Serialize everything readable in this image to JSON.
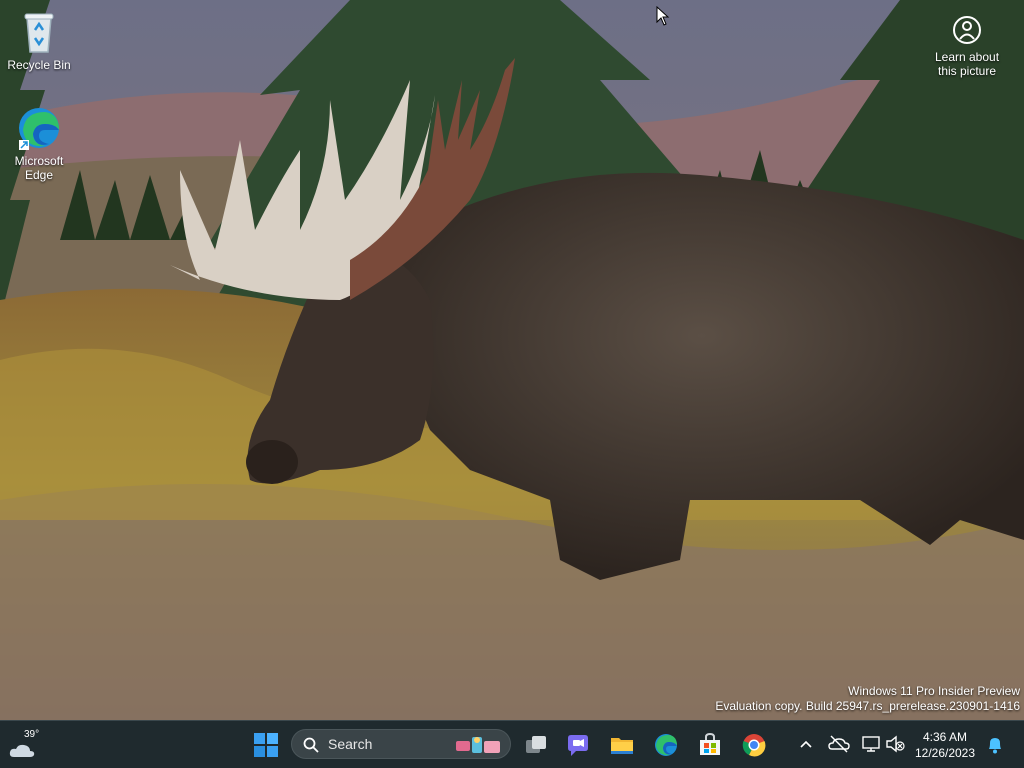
{
  "desktop": {
    "icons": [
      {
        "label": "Recycle Bin",
        "icon": "recycle-bin-icon"
      },
      {
        "label": "Microsoft\nEdge",
        "icon": "edge-icon"
      }
    ],
    "learn_label": "Learn about\nthis picture",
    "learn_icon": "camera-info-icon",
    "watermark": {
      "line1": "Windows 11 Pro Insider Preview",
      "line2": "Evaluation copy. Build 25947.rs_prerelease.230901-1416"
    }
  },
  "taskbar": {
    "weather": {
      "temp": "39°",
      "icon": "cloud-moon-icon"
    },
    "start_icon": "windows-start-icon",
    "search": {
      "label": "Search",
      "icon": "search-icon"
    },
    "apps": [
      {
        "name": "Task View",
        "icon": "task-view-icon"
      },
      {
        "name": "Chat",
        "icon": "chat-icon"
      },
      {
        "name": "File Explorer",
        "icon": "folder-icon"
      },
      {
        "name": "Microsoft Edge",
        "icon": "edge-icon"
      },
      {
        "name": "Microsoft Store",
        "icon": "store-icon"
      },
      {
        "name": "Google Chrome",
        "icon": "chrome-icon"
      }
    ],
    "tray": {
      "chevron_icon": "chevron-up-icon",
      "onedrive_icon": "onedrive-offline-icon",
      "network_icon": "network-icon",
      "volume_icon": "volume-muted-icon",
      "time": "4:36 AM",
      "date": "12/26/2023",
      "bell_icon": "notification-bell-icon"
    }
  },
  "colors": {
    "taskbar_bg": "#1f2a2e",
    "accent": "#0078d4"
  }
}
